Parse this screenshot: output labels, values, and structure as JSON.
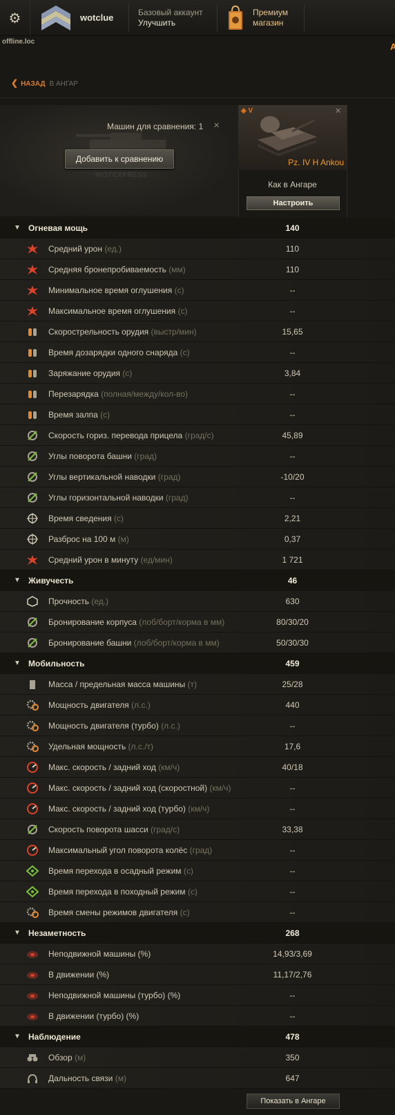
{
  "topbar": {
    "username": "wotclue",
    "account_line1": "Базовый аккаунт",
    "account_line2": "Улучшить",
    "shop_line1": "Премиум",
    "shop_line2": "магазин",
    "right_letter": "A"
  },
  "server": "offline.loc",
  "nav": {
    "back_label": "НАЗАД",
    "back_target": "В АНГАР"
  },
  "compare": {
    "count_label": "Машин для сравнения: 1",
    "add_button": "Добавить к сравнению",
    "watermark": "WOTEXPRESS"
  },
  "tank": {
    "level": "V",
    "name": "Pz. IV H Ankou",
    "config_label": "Как в Ангаре",
    "config_button": "Настроить"
  },
  "sections": [
    {
      "title": "Огневая мощь",
      "value": "140",
      "rows": [
        {
          "icon": "damage-icon",
          "label": "Средний урон",
          "unit": "(ед.)",
          "value": "110"
        },
        {
          "icon": "penetration-icon",
          "label": "Средняя бронепробиваемость",
          "unit": "(мм)",
          "value": "110"
        },
        {
          "icon": "stun-min-icon",
          "label": "Минимальное время оглушения",
          "unit": "(с)",
          "value": "--"
        },
        {
          "icon": "stun-max-icon",
          "label": "Максимальное время оглушения",
          "unit": "(с)",
          "value": "--"
        },
        {
          "icon": "rate-of-fire-icon",
          "label": "Скорострельность орудия",
          "unit": "(выстр/мин)",
          "value": "15,65"
        },
        {
          "icon": "shell-reload-icon",
          "label": "Время дозарядки одного снаряда",
          "unit": "(с)",
          "value": "--"
        },
        {
          "icon": "reload-icon",
          "label": "Заряжание орудия",
          "unit": "(с)",
          "value": "3,84"
        },
        {
          "icon": "clip-reload-icon",
          "label": "Перезарядка",
          "unit": "(полная/между/кол-во)",
          "value": "--"
        },
        {
          "icon": "salvo-icon",
          "label": "Время залпа",
          "unit": "(с)",
          "value": "--"
        },
        {
          "icon": "traverse-speed-icon",
          "label": "Скорость гориз. перевода прицела",
          "unit": "(град/с)",
          "value": "45,89"
        },
        {
          "icon": "turret-angles-icon",
          "label": "Углы поворота башни",
          "unit": "(град)",
          "value": "--"
        },
        {
          "icon": "elevation-icon",
          "label": "Углы вертикальной наводки",
          "unit": "(град)",
          "value": "-10/20"
        },
        {
          "icon": "horizontal-aim-icon",
          "label": "Углы горизонтальной наводки",
          "unit": "(град)",
          "value": "--"
        },
        {
          "icon": "aim-time-icon",
          "label": "Время сведения",
          "unit": "(с)",
          "value": "2,21"
        },
        {
          "icon": "dispersion-icon",
          "label": "Разброс на 100 м",
          "unit": "(м)",
          "value": "0,37"
        },
        {
          "icon": "dpm-icon",
          "label": "Средний урон в минуту",
          "unit": "(ед/мин)",
          "value": "1 721"
        }
      ]
    },
    {
      "title": "Живучесть",
      "value": "46",
      "rows": [
        {
          "icon": "hitpoints-icon",
          "label": "Прочность",
          "unit": "(ед.)",
          "value": "630"
        },
        {
          "icon": "hull-armor-icon",
          "label": "Бронирование корпуса",
          "unit": "(лоб/борт/корма в мм)",
          "value": "80/30/20"
        },
        {
          "icon": "turret-armor-icon",
          "label": "Бронирование башни",
          "unit": "(лоб/борт/корма в мм)",
          "value": "50/30/30"
        }
      ]
    },
    {
      "title": "Мобильность",
      "value": "459",
      "rows": [
        {
          "icon": "weight-icon",
          "label": "Масса / предельная масса машины",
          "unit": "(т)",
          "value": "25/28"
        },
        {
          "icon": "engine-icon",
          "label": "Мощность двигателя",
          "unit": "(л.с.)",
          "value": "440"
        },
        {
          "icon": "engine-turbo-icon",
          "label": "Мощность двигателя (турбо)",
          "unit": "(л.с.)",
          "value": "--"
        },
        {
          "icon": "power-ratio-icon",
          "label": "Удельная мощность",
          "unit": "(л.с./т)",
          "value": "17,6"
        },
        {
          "icon": "speed-icon",
          "label": "Макс. скорость / задний ход",
          "unit": "(км/ч)",
          "value": "40/18"
        },
        {
          "icon": "speed-fast-icon",
          "label": "Макс. скорость / задний ход (скоростной)",
          "unit": "(км/ч)",
          "value": "--"
        },
        {
          "icon": "speed-turbo-icon",
          "label": "Макс. скорость / задний ход (турбо)",
          "unit": "(км/ч)",
          "value": "--"
        },
        {
          "icon": "hull-traverse-icon",
          "label": "Скорость поворота шасси",
          "unit": "(град/с)",
          "value": "33,38"
        },
        {
          "icon": "wheel-angle-icon",
          "label": "Максимальный угол поворота колёс",
          "unit": "(град)",
          "value": "--"
        },
        {
          "icon": "siege-mode-icon",
          "label": "Время перехода в осадный режим ",
          "unit": "(с)",
          "value": "--"
        },
        {
          "icon": "travel-mode-icon",
          "label": "Время перехода в походный режим ",
          "unit": "(с)",
          "value": "--"
        },
        {
          "icon": "engine-mode-icon",
          "label": "Время смены режимов двигателя",
          "unit": "(с)",
          "value": "--"
        }
      ]
    },
    {
      "title": "Незаметность",
      "value": "268",
      "rows": [
        {
          "icon": "camo-stationary-icon",
          "label": "Неподвижной машины (%)",
          "unit": "",
          "value": "14,93/3,69"
        },
        {
          "icon": "camo-moving-icon",
          "label": "В движении (%)",
          "unit": "",
          "value": "11,17/2,76"
        },
        {
          "icon": "camo-stationary-turbo-icon",
          "label": "Неподвижной машины (турбо) (%)",
          "unit": "",
          "value": "--"
        },
        {
          "icon": "camo-moving-turbo-icon",
          "label": "В движении (турбо) (%)",
          "unit": "",
          "value": "--"
        }
      ]
    },
    {
      "title": "Наблюдение",
      "value": "478",
      "rows": [
        {
          "icon": "view-range-icon",
          "label": "Обзор",
          "unit": "(м)",
          "value": "350"
        },
        {
          "icon": "radio-range-icon",
          "label": "Дальность связи",
          "unit": "(м)",
          "value": "647"
        }
      ]
    }
  ],
  "footer": {
    "show_in_hangar": "Показать в Ангаре"
  },
  "colors": {
    "accent": "#f29a2c",
    "background": "#1a1814",
    "section_bg": "#16150f"
  }
}
